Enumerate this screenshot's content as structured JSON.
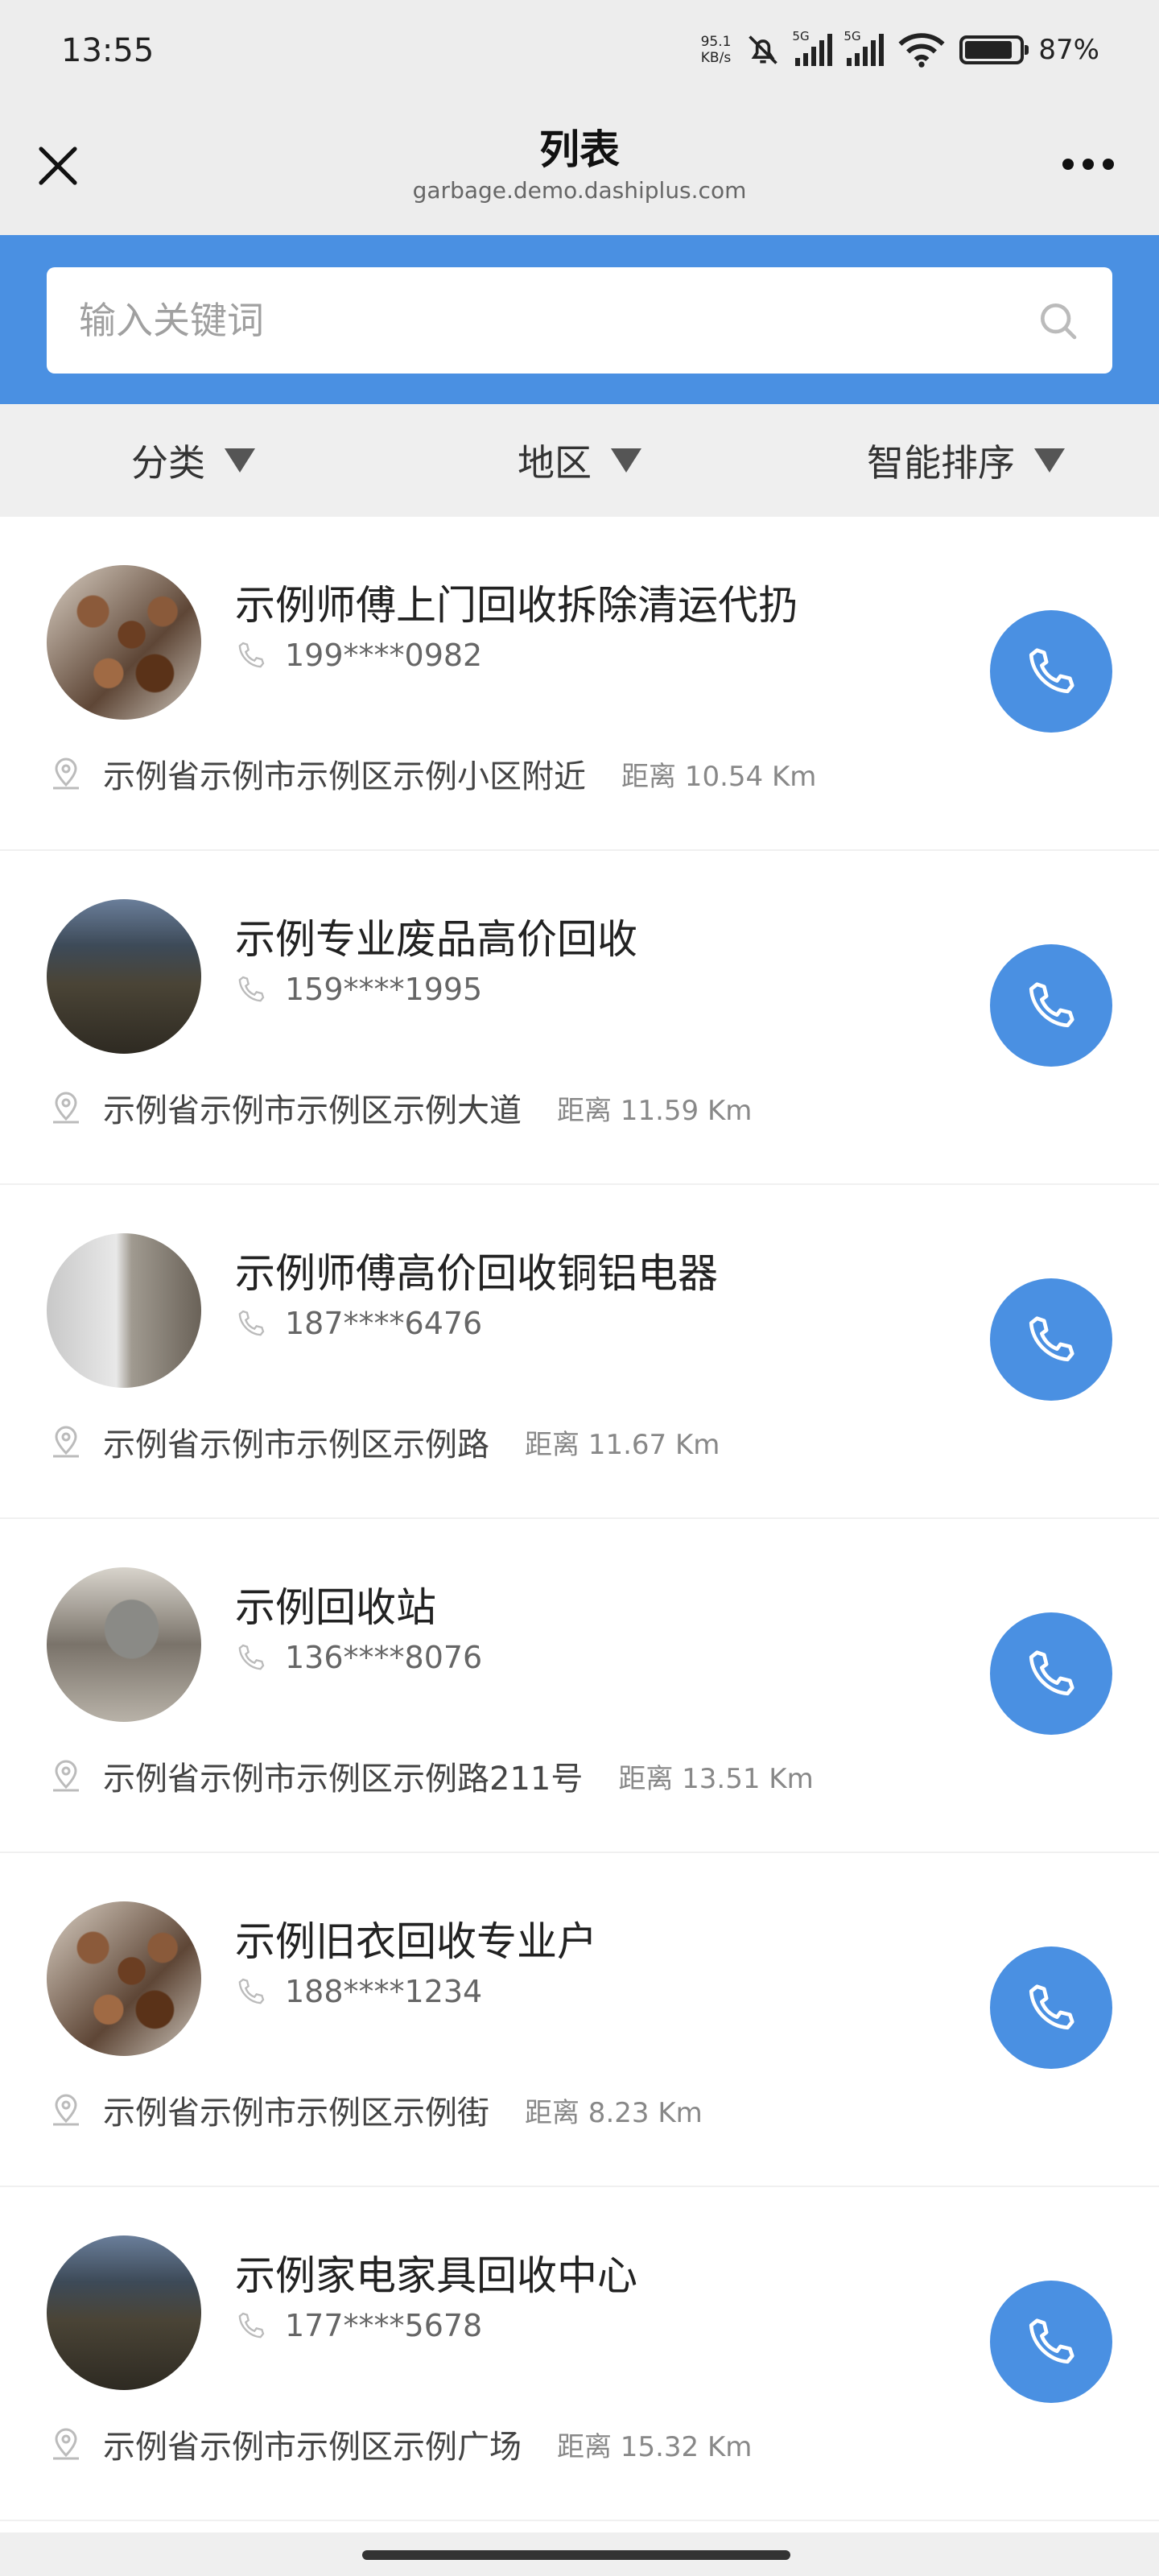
{
  "status_bar": {
    "time": "13:55",
    "net_speed_value": "95.1",
    "net_speed_unit": "KB/s",
    "signal1_label": "5G",
    "signal2_label": "5G",
    "battery": "87%",
    "battery_level": 0.87
  },
  "nav": {
    "title": "列表",
    "subtitle": "garbage.demo.dashiplus.com"
  },
  "search": {
    "placeholder": "输入关键词"
  },
  "filters": [
    {
      "label": "分类"
    },
    {
      "label": "地区"
    },
    {
      "label": "智能排序"
    }
  ],
  "items": [
    {
      "title": "示例师傅上门回收拆除清运代扔",
      "phone": "199****0982",
      "address": "示例省示例市示例区示例小区附近",
      "distance": "距离 10.54 Km"
    },
    {
      "title": "示例专业废品高价回收",
      "phone": "159****1995",
      "address": "示例省示例市示例区示例大道",
      "distance": "距离 11.59 Km"
    },
    {
      "title": "示例师傅高价回收铜铝电器",
      "phone": "187****6476",
      "address": "示例省示例市示例区示例路",
      "distance": "距离 11.67 Km"
    },
    {
      "title": "示例回收站",
      "phone": "136****8076",
      "address": "示例省示例市示例区示例路211号",
      "distance": "距离 13.51 Km"
    },
    {
      "title": "示例旧衣回收专业户",
      "phone": "188****1234",
      "address": "示例省示例市示例区示例街",
      "distance": "距离 8.23 Km"
    },
    {
      "title": "示例家电家具回收中心",
      "phone": "177****5678",
      "address": "示例省示例市示例区示例广场",
      "distance": "距离 15.32 Km"
    }
  ],
  "colors": {
    "accent": "#4a90e2",
    "nav_bg": "#ededed"
  }
}
